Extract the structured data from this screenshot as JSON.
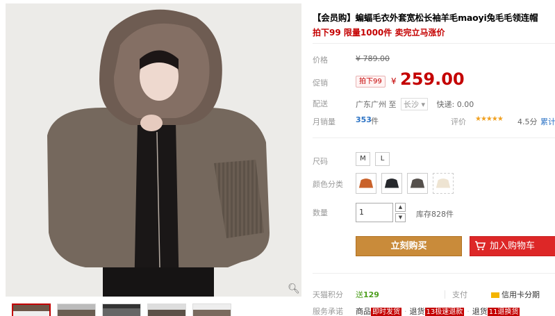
{
  "gallery": {
    "zoom_icon": "magnifier-icon",
    "thumbnail_count": 5
  },
  "product": {
    "title": "【会员购】蝙蝠毛衣外套宽松长袖羊毛maoyi兔毛毛领连帽",
    "promo_line": "拍下99 限量1000件 卖完立马涨价"
  },
  "price": {
    "label": "价格",
    "original": "¥ 789.00",
    "promo_label": "促销",
    "promo_tag": "拍下99",
    "symbol": "¥",
    "current": "259.00"
  },
  "shipping": {
    "label": "配送",
    "from": "广东广州",
    "to_word": "至",
    "to_city": "长沙 ▾",
    "fee": "快递: 0.00"
  },
  "sales": {
    "label": "月销量",
    "count": "353",
    "unit": "件",
    "rating_label": "评价",
    "stars": "★★★★★",
    "rating_score": "4.5分",
    "rating_count_label": "累计"
  },
  "options": {
    "size_label": "尺码",
    "sizes": [
      "M",
      "L"
    ],
    "color_label": "颜色分类",
    "qty_label": "数量",
    "qty_value": "1",
    "stock": "库存828件"
  },
  "actions": {
    "buy_now": "立刻购买",
    "add_to_cart": "加入购物车"
  },
  "footer": {
    "points_label": "天猫积分",
    "points_prefix": "送",
    "points_value": "129",
    "pay_label": "支付",
    "pay_credit": "信用卡分期",
    "service_label": "服务承诺",
    "service_text": "商品",
    "badge_1": "即时发货",
    "service_mid": "退货",
    "badge_2": "13极速退款",
    "service_end": "退货",
    "badge_3": "11退换货"
  },
  "colors": {
    "accent_red": "#c40000",
    "buy_button": "#c98b3a",
    "cart_button": "#dd2727",
    "link_blue": "#2c73c5"
  }
}
